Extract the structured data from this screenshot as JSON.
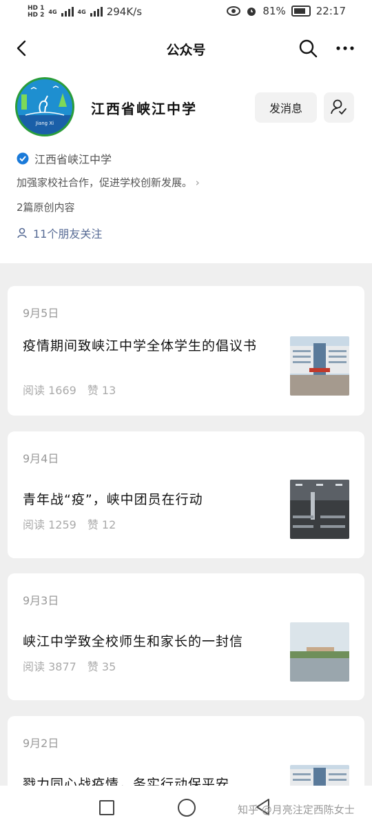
{
  "status_bar": {
    "hd1": "HD 1",
    "hd2": "HD 2",
    "net1": "4G",
    "net2": "4G",
    "speed": "294K/s",
    "battery": "81%",
    "time": "22:17"
  },
  "nav": {
    "title": "公众号"
  },
  "account": {
    "logo_text": "Jiang Xi",
    "name": "江西省峡江中学",
    "message_button": "发消息",
    "verified_name": "江西省峡江中学",
    "description": "加强家校社合作，促进学校创新发展。",
    "original_count": "2篇原创内容",
    "friends_following": "11个朋友关注"
  },
  "articles": [
    {
      "date": "9月5日",
      "title": "疫情期间致峡江中学全体学生的倡议书",
      "reads": "阅读 1669",
      "likes": "赞 13"
    },
    {
      "date": "9月4日",
      "title": "青年战“疫”，峡中团员在行动",
      "reads": "阅读 1259",
      "likes": "赞 12"
    },
    {
      "date": "9月3日",
      "title": "峡江中学致全校师生和家长的一封信",
      "reads": "阅读 3877",
      "likes": "赞 35"
    },
    {
      "date": "9月2日",
      "title": "戮力同心战疫情，务实行动保平安"
    }
  ],
  "watermark": "知乎 @月亮注定西陈女士"
}
